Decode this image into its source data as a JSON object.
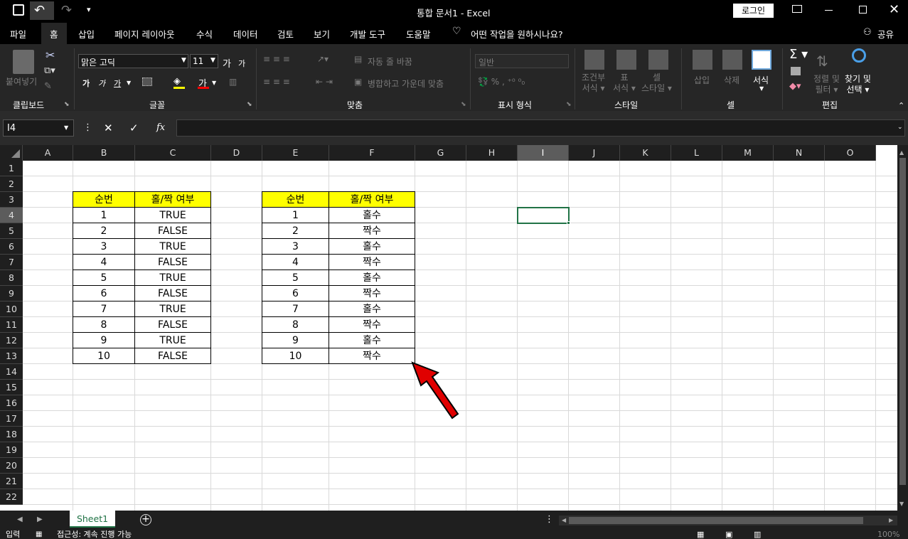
{
  "title": {
    "doc": "통합 문서1",
    "sep": "-",
    "app": "Excel",
    "login": "로그인"
  },
  "tabs": [
    "파일",
    "홈",
    "삽입",
    "페이지 레이아웃",
    "수식",
    "데이터",
    "검토",
    "보기",
    "개발 도구",
    "도움말"
  ],
  "tell_me": "어떤 작업을 원하시나요?",
  "share": "공유",
  "ribbon": {
    "paste": "붙여넣기",
    "font_name": "맑은 고딕",
    "font_size": "11",
    "bold": "가",
    "italic": "가",
    "underline": "가",
    "font_color_glyph": "가",
    "grow": "가",
    "shrink": "가",
    "wrap": "자동 줄 바꿈",
    "merge": "병합하고 가운데 맞춤",
    "number_format": "일반",
    "cond_format": "조건부\n서식",
    "table_format": "표\n서식",
    "cell_style": "셀\n스타일",
    "insert": "삽입",
    "delete": "삭제",
    "format": "서식",
    "sort_filter": "정렬 및\n필터",
    "find_select": "찾기 및\n선택",
    "groups": [
      "클립보드",
      "글꼴",
      "맞춤",
      "표시 형식",
      "스타일",
      "셀",
      "편집"
    ]
  },
  "formula": {
    "name_box": "I4",
    "fx": "fx",
    "content": ""
  },
  "columns": [
    "A",
    "B",
    "C",
    "D",
    "E",
    "F",
    "G",
    "H",
    "I",
    "J",
    "K",
    "L",
    "M",
    "N",
    "O"
  ],
  "rows": [
    "1",
    "2",
    "3",
    "4",
    "5",
    "6",
    "7",
    "8",
    "9",
    "10",
    "11",
    "12",
    "13",
    "14",
    "15",
    "16",
    "17",
    "18",
    "19",
    "20",
    "21",
    "22"
  ],
  "table1": {
    "headers": [
      "순번",
      "홀/짝 여부"
    ],
    "rows": [
      [
        "1",
        "TRUE"
      ],
      [
        "2",
        "FALSE"
      ],
      [
        "3",
        "TRUE"
      ],
      [
        "4",
        "FALSE"
      ],
      [
        "5",
        "TRUE"
      ],
      [
        "6",
        "FALSE"
      ],
      [
        "7",
        "TRUE"
      ],
      [
        "8",
        "FALSE"
      ],
      [
        "9",
        "TRUE"
      ],
      [
        "10",
        "FALSE"
      ]
    ]
  },
  "table2": {
    "headers": [
      "순번",
      "홀/짝 여부"
    ],
    "rows": [
      [
        "1",
        "홀수"
      ],
      [
        "2",
        "짝수"
      ],
      [
        "3",
        "홀수"
      ],
      [
        "4",
        "짝수"
      ],
      [
        "5",
        "홀수"
      ],
      [
        "6",
        "짝수"
      ],
      [
        "7",
        "홀수"
      ],
      [
        "8",
        "짝수"
      ],
      [
        "9",
        "홀수"
      ],
      [
        "10",
        "짝수"
      ]
    ]
  },
  "sheet_tab": "Sheet1",
  "status": {
    "ready": "입력",
    "accessibility": "접근성: 계속 진행 가능",
    "zoom": "100%"
  },
  "colors": {
    "header_fill": "#ffff00",
    "selection": "#217346",
    "arrow": "#e00000"
  }
}
